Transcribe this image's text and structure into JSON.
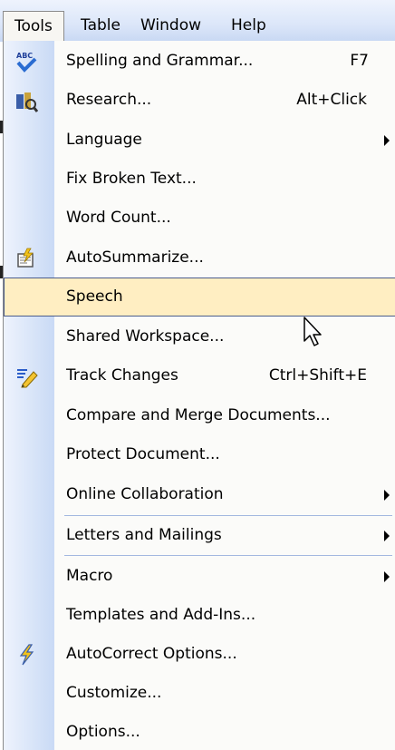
{
  "menubar": {
    "items": [
      {
        "label": "Tools",
        "state": "open"
      },
      {
        "label": "Table"
      },
      {
        "label": "Window"
      },
      {
        "label": "Help"
      }
    ]
  },
  "menu": {
    "items": [
      {
        "label": "Spelling and Grammar...",
        "shortcut": "F7",
        "icon": "spelling-abc-check-icon"
      },
      {
        "label": "Research...",
        "shortcut": "Alt+Click",
        "icon": "research-books-icon"
      },
      {
        "label": "Language",
        "submenu": true
      },
      {
        "label": "Fix Broken Text..."
      },
      {
        "label": "Word Count..."
      },
      {
        "label": "AutoSummarize...",
        "icon": "autosummarize-icon"
      },
      {
        "label": "Speech",
        "state": "highlighted"
      },
      {
        "label": "Shared Workspace..."
      },
      {
        "label": "Track Changes",
        "shortcut": "Ctrl+Shift+E",
        "icon": "track-changes-pencil-icon"
      },
      {
        "label": "Compare and Merge Documents..."
      },
      {
        "label": "Protect Document..."
      },
      {
        "label": "Online Collaboration",
        "submenu": true
      },
      {
        "label": "Letters and Mailings",
        "submenu": true
      },
      {
        "label": "Macro",
        "submenu": true
      },
      {
        "label": "Templates and Add-Ins..."
      },
      {
        "label": "AutoCorrect Options...",
        "icon": "lightning-icon"
      },
      {
        "label": "Customize..."
      },
      {
        "label": "Options..."
      }
    ]
  },
  "colors": {
    "highlight_fill": "#ffeec2",
    "highlight_border": "#4b5d8c",
    "gutter_light": "#eef3fd",
    "gutter_dark": "#c9daf5",
    "separator": "#a3b8e0"
  }
}
